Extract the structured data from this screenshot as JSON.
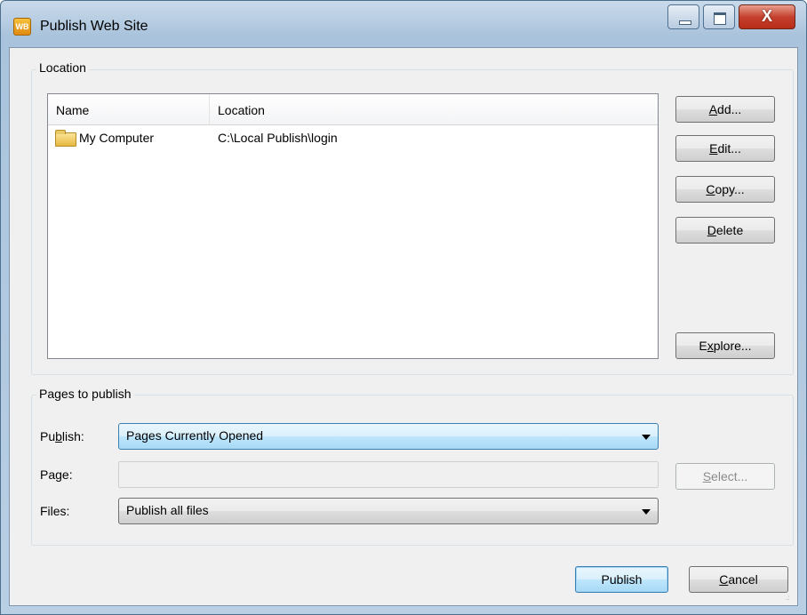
{
  "window": {
    "title": "Publish Web Site",
    "icon": "web-builder-app-icon",
    "close_glyph": "X"
  },
  "location_group": {
    "label": "Location",
    "list": {
      "columns": [
        "Name",
        "Location"
      ],
      "rows": [
        {
          "name": "My Computer",
          "location": "C:\\Local Publish\\login",
          "icon": "folder-icon"
        }
      ]
    },
    "buttons": {
      "add": {
        "pre": "",
        "key": "A",
        "post": "dd..."
      },
      "edit": {
        "pre": "",
        "key": "E",
        "post": "dit..."
      },
      "copy": {
        "pre": "",
        "key": "C",
        "post": "opy..."
      },
      "delete": {
        "pre": "",
        "key": "D",
        "post": "elete"
      },
      "explore": {
        "pre": "E",
        "key": "x",
        "post": "plore..."
      }
    }
  },
  "pages_group": {
    "label": "Pages to publish",
    "publish_label": {
      "pre": "Pu",
      "key": "b",
      "post": "lish:"
    },
    "publish_value": "Pages Currently Opened",
    "page_label": "Page:",
    "page_value": "",
    "files_label": "Files:",
    "files_value": "Publish all files",
    "select_button": {
      "pre": "",
      "key": "S",
      "post": "elect..."
    }
  },
  "footer": {
    "publish_button": "Publish",
    "cancel_button": {
      "pre": "",
      "key": "C",
      "post": "ancel"
    }
  },
  "colors": {
    "accent_button": "#bee6fd",
    "window_frame": "#b9cfe4",
    "close_button": "#c5412e"
  }
}
